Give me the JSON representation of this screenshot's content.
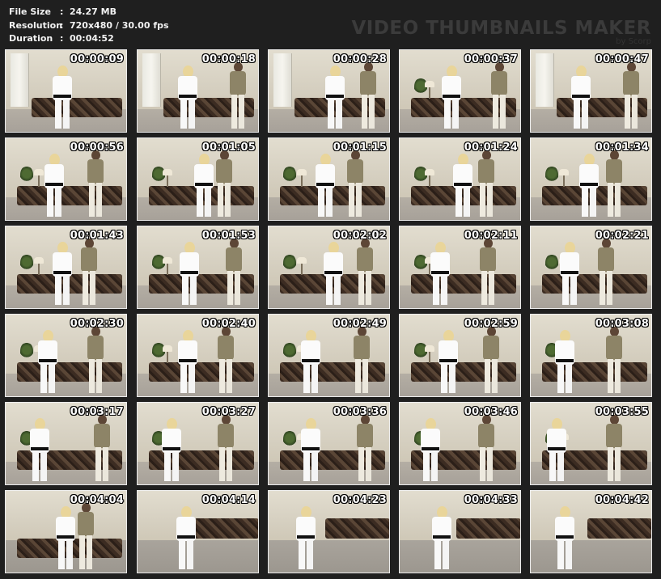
{
  "header": {
    "info": [
      {
        "key": "File Size",
        "value": "24.27 MB"
      },
      {
        "key": "Resolution",
        "value": "720x480 / 30.00 fps"
      },
      {
        "key": "Duration",
        "value": "00:04:52"
      }
    ],
    "separator": ":",
    "brand_title": "VIDEO THUMBNAILS MAKER",
    "brand_sub": "by Scorp"
  },
  "thumbnails": [
    {
      "timecode": "00:00:09"
    },
    {
      "timecode": "00:00:18"
    },
    {
      "timecode": "00:00:28"
    },
    {
      "timecode": "00:00:37"
    },
    {
      "timecode": "00:00:47"
    },
    {
      "timecode": "00:00:56"
    },
    {
      "timecode": "00:01:05"
    },
    {
      "timecode": "00:01:15"
    },
    {
      "timecode": "00:01:24"
    },
    {
      "timecode": "00:01:34"
    },
    {
      "timecode": "00:01:43"
    },
    {
      "timecode": "00:01:53"
    },
    {
      "timecode": "00:02:02"
    },
    {
      "timecode": "00:02:11"
    },
    {
      "timecode": "00:02:21"
    },
    {
      "timecode": "00:02:30"
    },
    {
      "timecode": "00:02:40"
    },
    {
      "timecode": "00:02:49"
    },
    {
      "timecode": "00:02:59"
    },
    {
      "timecode": "00:03:08"
    },
    {
      "timecode": "00:03:17"
    },
    {
      "timecode": "00:03:27"
    },
    {
      "timecode": "00:03:36"
    },
    {
      "timecode": "00:03:46"
    },
    {
      "timecode": "00:03:55"
    },
    {
      "timecode": "00:04:04"
    },
    {
      "timecode": "00:04:14"
    },
    {
      "timecode": "00:04:23"
    },
    {
      "timecode": "00:04:33"
    },
    {
      "timecode": "00:04:42"
    }
  ],
  "grid": {
    "columns": 5,
    "rows": 6
  },
  "colors": {
    "background": "#1f1f1f",
    "tile_border": "#ececec",
    "timecode": "#ffffff",
    "info_text": "#f2f2f2",
    "brand": "#3b3b3b"
  }
}
